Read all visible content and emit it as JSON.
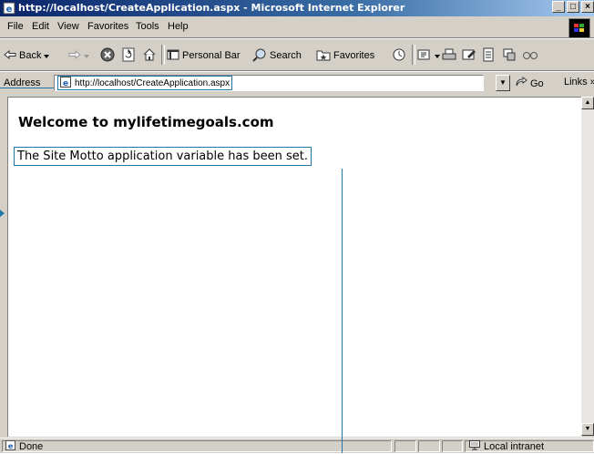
{
  "window": {
    "title": "http://localhost/CreateApplication.aspx - Microsoft Internet Explorer",
    "buttons": [
      "_",
      "□",
      "×"
    ]
  },
  "menu": {
    "items": [
      "File",
      "Edit",
      "View",
      "Favorites",
      "Tools",
      "Help"
    ]
  },
  "toolbar": {
    "back_label": "Back",
    "personal_bar_label": "Personal Bar",
    "search_label": "Search",
    "favorites_label": "Favorites"
  },
  "address": {
    "label": "Address",
    "url": "http://localhost/CreateApplication.aspx",
    "go_label": "Go",
    "links_label": "Links"
  },
  "page": {
    "heading": "Welcome to mylifetimegoals.com",
    "message": "The Site Motto application variable has been set."
  },
  "status": {
    "text": "Done",
    "zone": "Local intranet"
  },
  "colors": {
    "titlebar_start": "#0a246a",
    "titlebar_end": "#a6caf0",
    "chrome": "#d4d0c8",
    "callout": "#2277aa"
  }
}
